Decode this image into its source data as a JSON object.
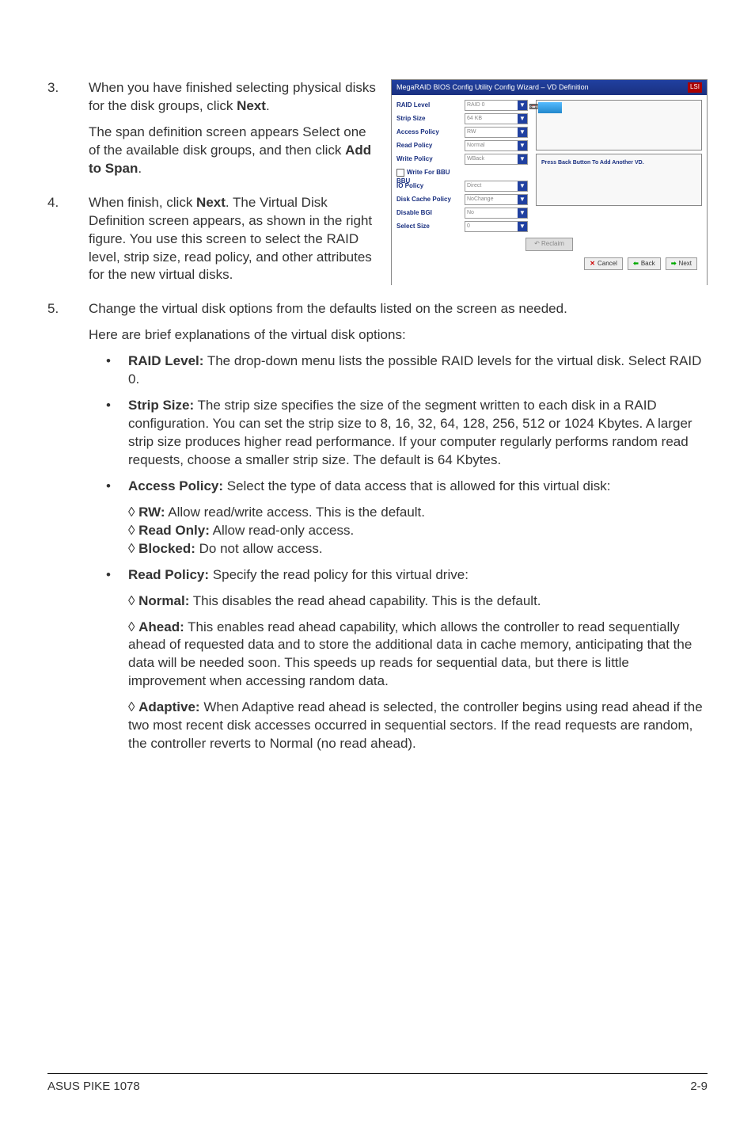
{
  "steps": {
    "s3": {
      "num": "3.",
      "p1a": "When you have finished selecting physical disks for the disk groups, click ",
      "p1b": "Next",
      "p1c": ".",
      "p2a": "The span definition screen appears Select one of the available disk groups, and then click ",
      "p2b": "Add to Span",
      "p2c": "."
    },
    "s4": {
      "num": "4.",
      "p1a": "When finish, click ",
      "p1b": "Next",
      "p1c": ". The Virtual Disk Definition screen appears, as shown in the right figure. You use this screen to select the RAID level, strip size, read policy, and other attributes for the new virtual disks."
    },
    "s5": {
      "num": "5.",
      "p1": "Change the virtual disk options from the defaults listed on the screen as needed.",
      "p2": "Here are brief explanations of the virtual disk options:"
    }
  },
  "bullets": {
    "raid": {
      "label": "RAID Level:",
      "text": " The drop-down menu lists the possible RAID levels for the virtual disk. Select RAID 0."
    },
    "strip": {
      "label": "Strip Size:",
      "text": " The strip size specifies the size of the segment written to each disk in a RAID configuration. You can set the strip size to 8, 16, 32, 64, 128, 256, 512 or 1024 Kbytes. A larger strip size produces higher read performance. If your computer regularly performs random read requests, choose a smaller strip size. The default is 64 Kbytes."
    },
    "access": {
      "label": "Access Policy:",
      "text": " Select the type of data access that is allowed for this virtual disk:"
    },
    "access_rw": {
      "sym": "◊ ",
      "label": "RW:",
      "text": " Allow read/write access. This is the default."
    },
    "access_ro": {
      "sym": "◊ ",
      "label": "Read Only:",
      "text": " Allow read-only access."
    },
    "access_bl": {
      "sym": "◊ ",
      "label": "Blocked:",
      "text": " Do not allow access."
    },
    "read": {
      "label": "Read Policy:",
      "text": " Specify the read policy for this virtual drive:"
    },
    "read_normal": {
      "sym": "◊ ",
      "label": "Normal:",
      "text": " This disables the read ahead capability. This is the default."
    },
    "read_ahead": {
      "sym": "◊ ",
      "label": "Ahead:",
      "text": " This enables read ahead capability, which allows the controller to read sequentially ahead of requested data and to store the additional data in cache memory, anticipating that the data will be needed soon. This speeds up reads for sequential data, but there is little improvement when accessing random data."
    },
    "read_adaptive": {
      "sym": "◊ ",
      "label": "Adaptive:",
      "text": " When Adaptive read ahead is selected, the controller begins using read ahead if the two most recent disk accesses occurred in sequential sectors. If the read requests are random, the controller reverts to Normal (no read ahead)."
    }
  },
  "screenshot": {
    "title": "MegaRAID BIOS Config Utility Config Wizard – VD Definition",
    "fields": {
      "raid_level": {
        "label": "RAID Level",
        "value": "RAID 0"
      },
      "strip_size": {
        "label": "Strip Size",
        "value": "64 KB"
      },
      "access_policy": {
        "label": "Access Policy",
        "value": "RW"
      },
      "read_policy": {
        "label": "Read Policy",
        "value": "Normal"
      },
      "write_policy": {
        "label": "Write Policy",
        "value": "WBack"
      },
      "write_group": {
        "label": "Write For BBU BBU"
      },
      "io_policy": {
        "label": "IO Policy",
        "value": "Direct"
      },
      "disk_cache": {
        "label": "Disk Cache Policy",
        "value": "NoChange"
      },
      "disable_bgi": {
        "label": "Disable BGI",
        "value": "No"
      },
      "select_size": {
        "label": "Select Size",
        "value": "0"
      }
    },
    "right_text": "Press Back Button To Add Another VD.",
    "buttons": {
      "reclaim": "Reclaim",
      "cancel": "Cancel",
      "back": "Back",
      "next": "Next"
    }
  },
  "footer": {
    "left": "ASUS PIKE 1078",
    "right": "2-9"
  }
}
